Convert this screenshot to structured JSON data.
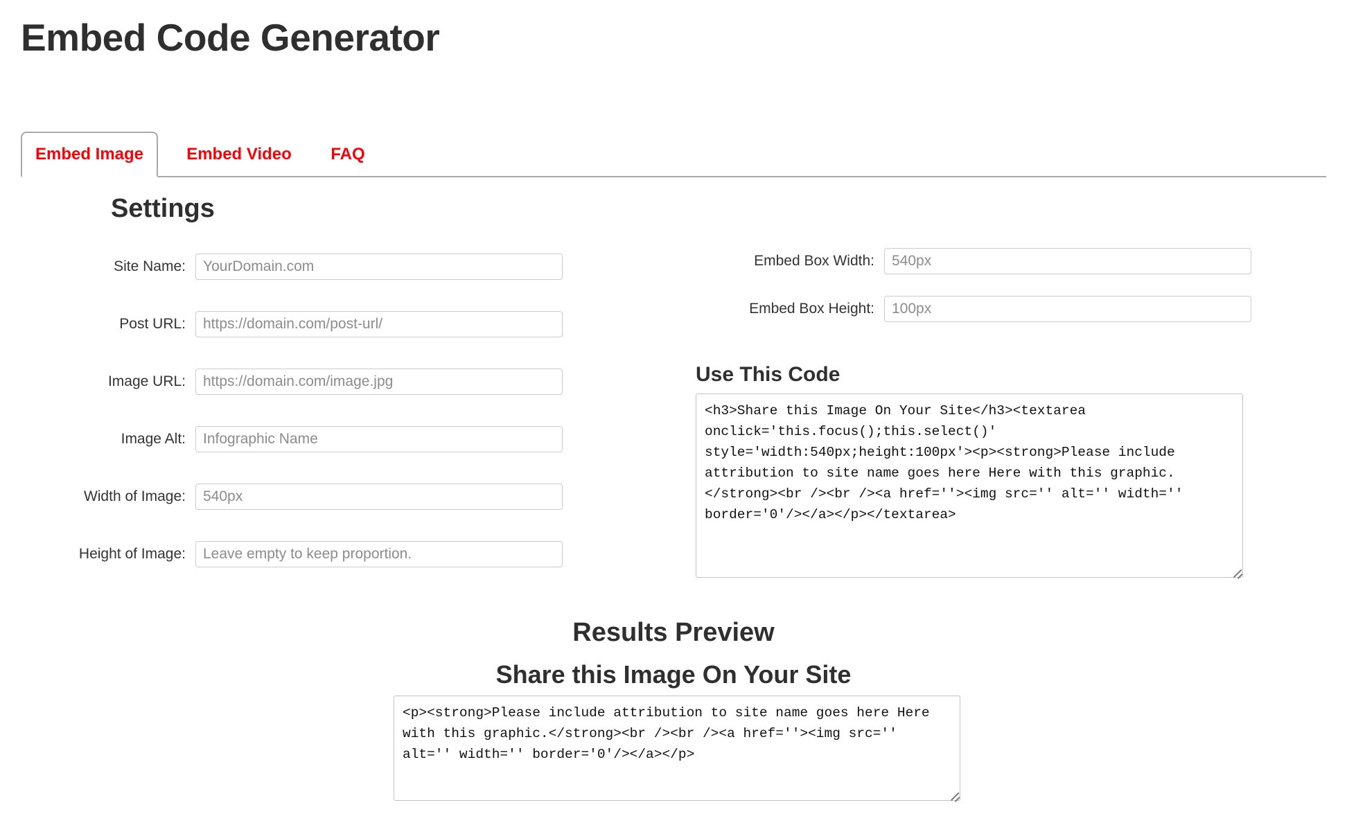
{
  "header": {
    "title": "Embed Code Generator"
  },
  "tabs": [
    {
      "label": "Embed Image",
      "active": true
    },
    {
      "label": "Embed Video",
      "active": false
    },
    {
      "label": "FAQ",
      "active": false
    }
  ],
  "settings": {
    "heading": "Settings",
    "left_fields": [
      {
        "label": "Site Name:",
        "placeholder": "YourDomain.com",
        "value": ""
      },
      {
        "label": "Post URL:",
        "placeholder": "https://domain.com/post-url/",
        "value": ""
      },
      {
        "label": "Image URL:",
        "placeholder": "https://domain.com/image.jpg",
        "value": ""
      },
      {
        "label": "Image Alt:",
        "placeholder": "Infographic Name",
        "value": ""
      },
      {
        "label": "Width of Image:",
        "placeholder": "540px",
        "value": ""
      },
      {
        "label": "Height of Image:",
        "placeholder": "Leave empty to keep proportion.",
        "value": ""
      }
    ],
    "right_fields": [
      {
        "label": "Embed Box Width:",
        "placeholder": "540px",
        "value": ""
      },
      {
        "label": "Embed Box Height:",
        "placeholder": "100px",
        "value": ""
      }
    ]
  },
  "code": {
    "heading": "Use This Code",
    "content": "<h3>Share this Image On Your Site</h3><textarea onclick='this.focus();this.select()' style='width:540px;height:100px'><p><strong>Please include attribution to site name goes here Here with this graphic.</strong><br /><br /><a href=''><img src='' alt='' width='' border='0'/></a></p></textarea>"
  },
  "results": {
    "title": "Results Preview",
    "share_title": "Share this Image On Your Site",
    "preview_content": "<p><strong>Please include attribution to site name goes here Here with this graphic.</strong><br /><br /><a href=''><img src='' alt='' width='' border='0'/></a></p>"
  },
  "colors": {
    "tab_red": "#fb0007",
    "heading_dark": "#2f2f2f",
    "border_gray": "#c4c4c4",
    "placeholder_gray": "#8c8c8c"
  },
  "icons": {
    "resize_handle": "resize-handle-icon"
  }
}
